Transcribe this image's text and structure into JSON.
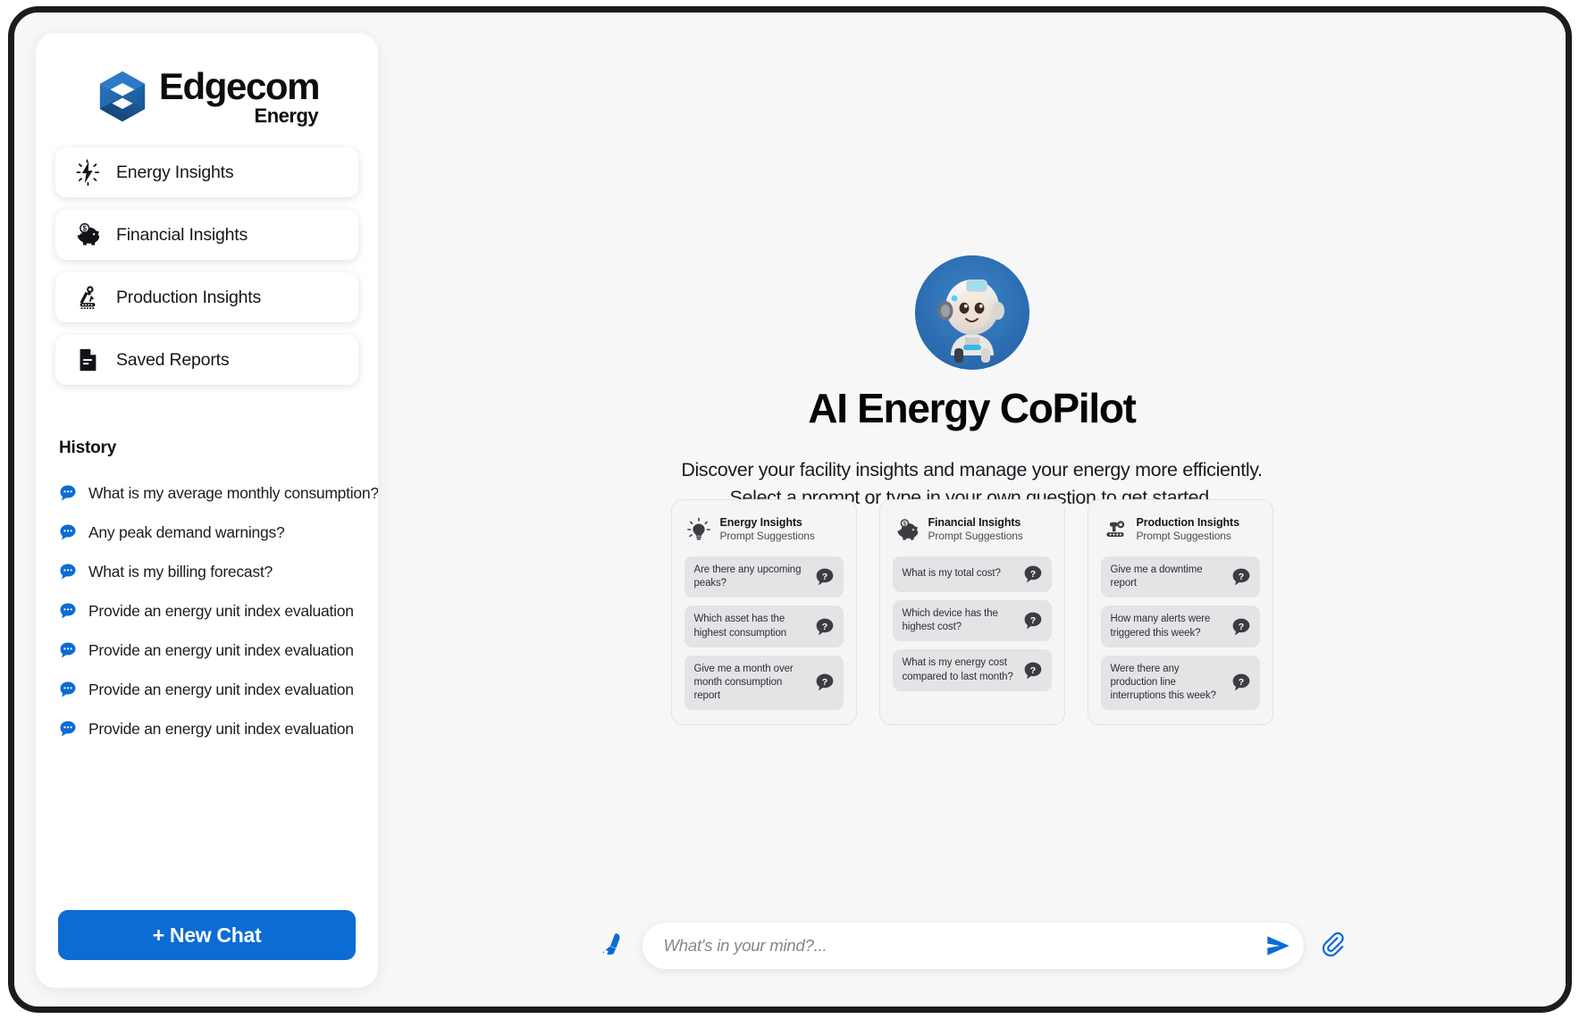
{
  "brand": {
    "name": "Edgecom",
    "sub": "Energy",
    "logo_icon": "edgecom-hexagon-logo",
    "accent_blue": "#1b63ab",
    "accent_blue_dark": "#0d3f72"
  },
  "sidebar": {
    "nav": [
      {
        "label": "Energy Insights",
        "icon": "lightning-bolt-icon"
      },
      {
        "label": "Financial Insights",
        "icon": "piggy-bank-icon"
      },
      {
        "label": "Production Insights",
        "icon": "robot-arm-icon"
      },
      {
        "label": "Saved Reports",
        "icon": "document-icon"
      }
    ],
    "history_title": "History",
    "history": [
      {
        "label": "What is my average monthly consumption?",
        "icon": "chat-bubble-icon"
      },
      {
        "label": "Any peak demand warnings?",
        "icon": "chat-bubble-icon"
      },
      {
        "label": "What is my billing forecast?",
        "icon": "chat-bubble-icon"
      },
      {
        "label": "Provide an energy unit index evaluation",
        "icon": "chat-bubble-icon"
      },
      {
        "label": "Provide an energy unit index evaluation",
        "icon": "chat-bubble-icon"
      },
      {
        "label": "Provide an energy unit index evaluation",
        "icon": "chat-bubble-icon"
      },
      {
        "label": "Provide an energy unit index evaluation",
        "icon": "chat-bubble-icon"
      }
    ],
    "new_chat_label": "+ New Chat",
    "new_chat_color": "#0b6cd4"
  },
  "hero": {
    "avatar_icon": "robot-mascot-avatar",
    "title": "AI Energy CoPilot",
    "subtitle": "Discover your facility insights and manage your energy more efficiently. Select a prompt or type in your own question to get started."
  },
  "cards": [
    {
      "title": "Energy Insights",
      "subtitle": "Prompt Suggestions",
      "icon": "lightbulb-icon",
      "prompts": [
        "Are there any upcoming peaks?",
        "Which asset has the highest consumption",
        "Give me a month over month consumption report"
      ]
    },
    {
      "title": "Financial Insights",
      "subtitle": "Prompt Suggestions",
      "icon": "piggy-bank-icon",
      "prompts": [
        "What is my total cost?",
        "Which device has the highest cost?",
        "What is my energy cost compared to last month?"
      ]
    },
    {
      "title": "Production Insights",
      "subtitle": "Prompt Suggestions",
      "icon": "robot-arm-icon",
      "prompts": [
        "Give me a downtime report",
        "How many alerts were triggered this week?",
        "Were there any production line interruptions this week?"
      ]
    }
  ],
  "composer": {
    "placeholder": "What's in your mind?...",
    "value": "",
    "clear_icon": "broom-icon",
    "send_icon": "send-paper-plane-icon",
    "attach_icon": "paperclip-icon",
    "icon_color": "#0b6cd4"
  }
}
